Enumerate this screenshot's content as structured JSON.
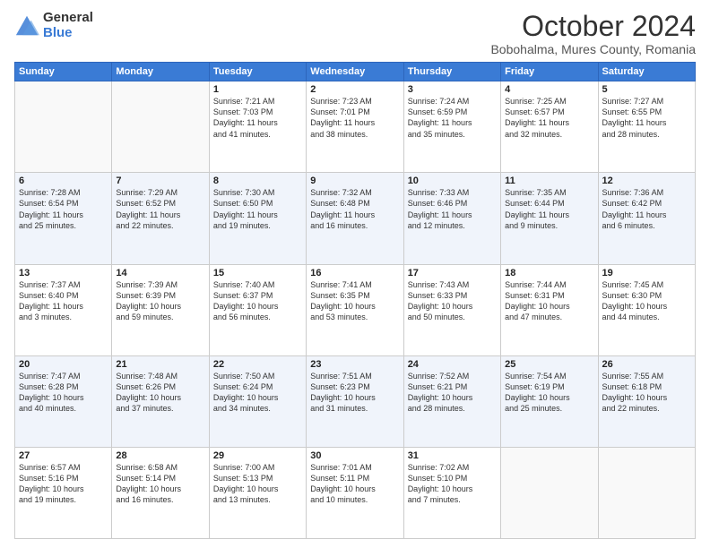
{
  "logo": {
    "general": "General",
    "blue": "Blue"
  },
  "title": "October 2024",
  "subtitle": "Bobohalma, Mures County, Romania",
  "days_header": [
    "Sunday",
    "Monday",
    "Tuesday",
    "Wednesday",
    "Thursday",
    "Friday",
    "Saturday"
  ],
  "weeks": [
    [
      {
        "num": "",
        "info": ""
      },
      {
        "num": "",
        "info": ""
      },
      {
        "num": "1",
        "info": "Sunrise: 7:21 AM\nSunset: 7:03 PM\nDaylight: 11 hours\nand 41 minutes."
      },
      {
        "num": "2",
        "info": "Sunrise: 7:23 AM\nSunset: 7:01 PM\nDaylight: 11 hours\nand 38 minutes."
      },
      {
        "num": "3",
        "info": "Sunrise: 7:24 AM\nSunset: 6:59 PM\nDaylight: 11 hours\nand 35 minutes."
      },
      {
        "num": "4",
        "info": "Sunrise: 7:25 AM\nSunset: 6:57 PM\nDaylight: 11 hours\nand 32 minutes."
      },
      {
        "num": "5",
        "info": "Sunrise: 7:27 AM\nSunset: 6:55 PM\nDaylight: 11 hours\nand 28 minutes."
      }
    ],
    [
      {
        "num": "6",
        "info": "Sunrise: 7:28 AM\nSunset: 6:54 PM\nDaylight: 11 hours\nand 25 minutes."
      },
      {
        "num": "7",
        "info": "Sunrise: 7:29 AM\nSunset: 6:52 PM\nDaylight: 11 hours\nand 22 minutes."
      },
      {
        "num": "8",
        "info": "Sunrise: 7:30 AM\nSunset: 6:50 PM\nDaylight: 11 hours\nand 19 minutes."
      },
      {
        "num": "9",
        "info": "Sunrise: 7:32 AM\nSunset: 6:48 PM\nDaylight: 11 hours\nand 16 minutes."
      },
      {
        "num": "10",
        "info": "Sunrise: 7:33 AM\nSunset: 6:46 PM\nDaylight: 11 hours\nand 12 minutes."
      },
      {
        "num": "11",
        "info": "Sunrise: 7:35 AM\nSunset: 6:44 PM\nDaylight: 11 hours\nand 9 minutes."
      },
      {
        "num": "12",
        "info": "Sunrise: 7:36 AM\nSunset: 6:42 PM\nDaylight: 11 hours\nand 6 minutes."
      }
    ],
    [
      {
        "num": "13",
        "info": "Sunrise: 7:37 AM\nSunset: 6:40 PM\nDaylight: 11 hours\nand 3 minutes."
      },
      {
        "num": "14",
        "info": "Sunrise: 7:39 AM\nSunset: 6:39 PM\nDaylight: 10 hours\nand 59 minutes."
      },
      {
        "num": "15",
        "info": "Sunrise: 7:40 AM\nSunset: 6:37 PM\nDaylight: 10 hours\nand 56 minutes."
      },
      {
        "num": "16",
        "info": "Sunrise: 7:41 AM\nSunset: 6:35 PM\nDaylight: 10 hours\nand 53 minutes."
      },
      {
        "num": "17",
        "info": "Sunrise: 7:43 AM\nSunset: 6:33 PM\nDaylight: 10 hours\nand 50 minutes."
      },
      {
        "num": "18",
        "info": "Sunrise: 7:44 AM\nSunset: 6:31 PM\nDaylight: 10 hours\nand 47 minutes."
      },
      {
        "num": "19",
        "info": "Sunrise: 7:45 AM\nSunset: 6:30 PM\nDaylight: 10 hours\nand 44 minutes."
      }
    ],
    [
      {
        "num": "20",
        "info": "Sunrise: 7:47 AM\nSunset: 6:28 PM\nDaylight: 10 hours\nand 40 minutes."
      },
      {
        "num": "21",
        "info": "Sunrise: 7:48 AM\nSunset: 6:26 PM\nDaylight: 10 hours\nand 37 minutes."
      },
      {
        "num": "22",
        "info": "Sunrise: 7:50 AM\nSunset: 6:24 PM\nDaylight: 10 hours\nand 34 minutes."
      },
      {
        "num": "23",
        "info": "Sunrise: 7:51 AM\nSunset: 6:23 PM\nDaylight: 10 hours\nand 31 minutes."
      },
      {
        "num": "24",
        "info": "Sunrise: 7:52 AM\nSunset: 6:21 PM\nDaylight: 10 hours\nand 28 minutes."
      },
      {
        "num": "25",
        "info": "Sunrise: 7:54 AM\nSunset: 6:19 PM\nDaylight: 10 hours\nand 25 minutes."
      },
      {
        "num": "26",
        "info": "Sunrise: 7:55 AM\nSunset: 6:18 PM\nDaylight: 10 hours\nand 22 minutes."
      }
    ],
    [
      {
        "num": "27",
        "info": "Sunrise: 6:57 AM\nSunset: 5:16 PM\nDaylight: 10 hours\nand 19 minutes."
      },
      {
        "num": "28",
        "info": "Sunrise: 6:58 AM\nSunset: 5:14 PM\nDaylight: 10 hours\nand 16 minutes."
      },
      {
        "num": "29",
        "info": "Sunrise: 7:00 AM\nSunset: 5:13 PM\nDaylight: 10 hours\nand 13 minutes."
      },
      {
        "num": "30",
        "info": "Sunrise: 7:01 AM\nSunset: 5:11 PM\nDaylight: 10 hours\nand 10 minutes."
      },
      {
        "num": "31",
        "info": "Sunrise: 7:02 AM\nSunset: 5:10 PM\nDaylight: 10 hours\nand 7 minutes."
      },
      {
        "num": "",
        "info": ""
      },
      {
        "num": "",
        "info": ""
      }
    ]
  ]
}
